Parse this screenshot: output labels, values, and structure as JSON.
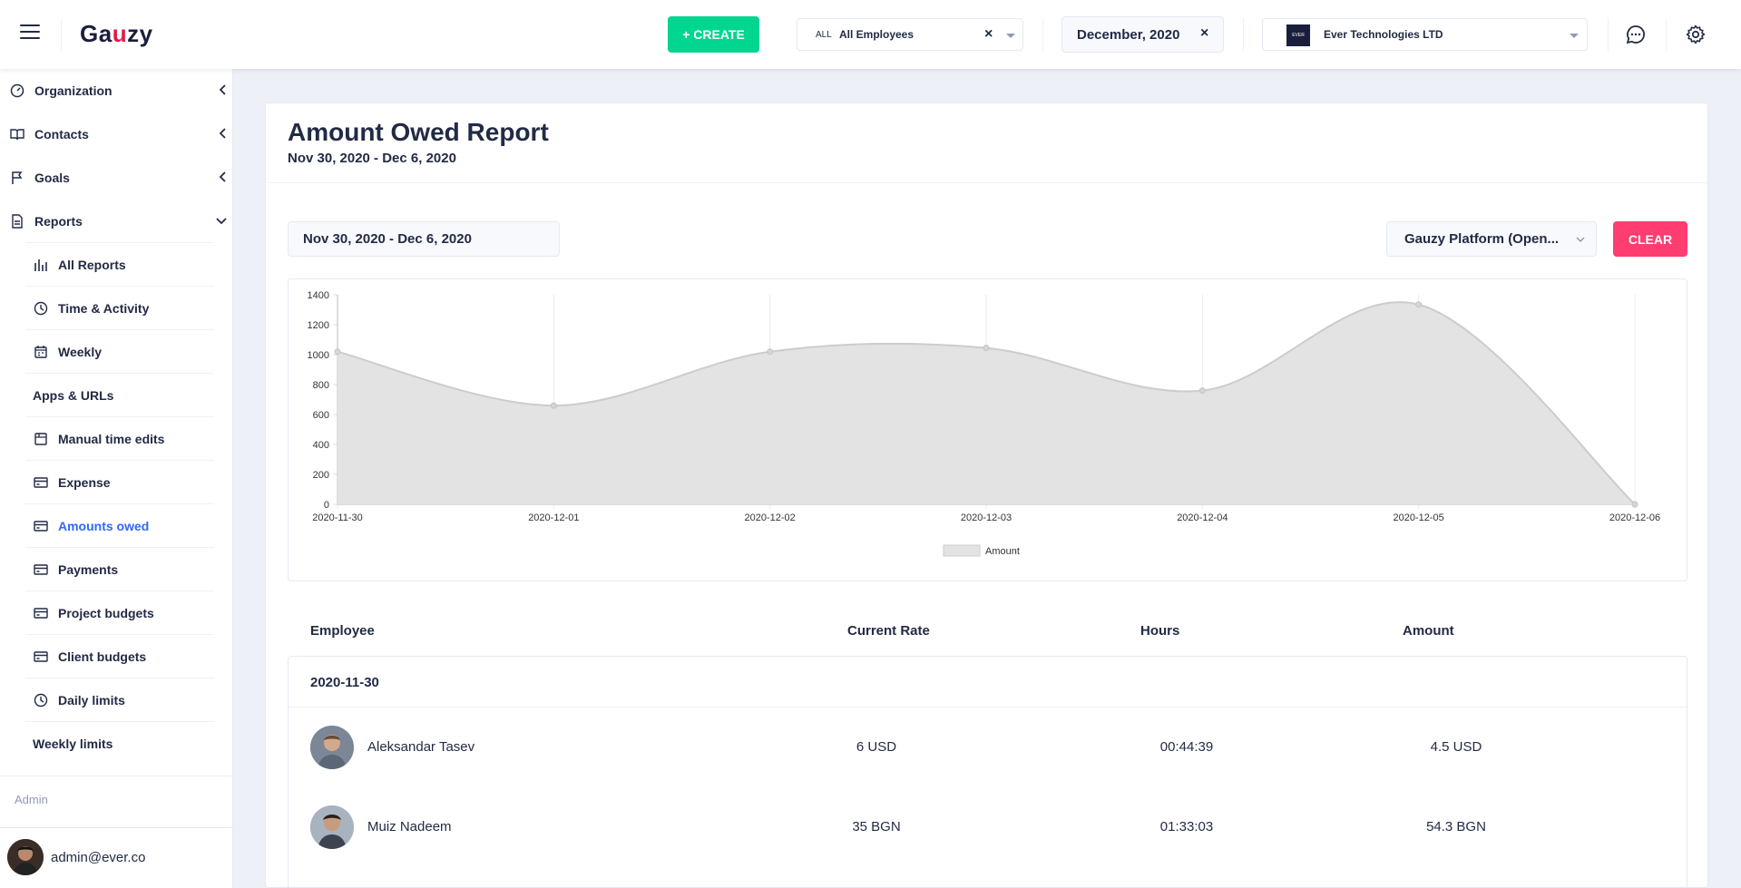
{
  "header": {
    "logo": "Gauzy",
    "create_label": "+ CREATE",
    "employee_badge": "ALL",
    "employee_value": "All Employees",
    "date_value": "December, 2020",
    "org_logo_text": "EVER",
    "org_value": "Ever Technologies LTD",
    "clear_glyph": "×"
  },
  "sidebar": {
    "top_items": [
      {
        "label": "Organization",
        "icon": "dashboard-icon"
      },
      {
        "label": "Contacts",
        "icon": "book-icon"
      },
      {
        "label": "Goals",
        "icon": "flag-icon"
      },
      {
        "label": "Reports",
        "icon": "file-icon"
      }
    ],
    "report_items": [
      {
        "label": "All Reports",
        "icon": "bar-chart-icon"
      },
      {
        "label": "Time & Activity",
        "icon": "clock-icon"
      },
      {
        "label": "Weekly",
        "icon": "calendar-icon"
      },
      {
        "label": "Apps & URLs",
        "icon": ""
      },
      {
        "label": "Manual time edits",
        "icon": "browser-icon"
      },
      {
        "label": "Expense",
        "icon": "credit-card-icon"
      },
      {
        "label": "Amounts owed",
        "icon": "credit-card-icon"
      },
      {
        "label": "Payments",
        "icon": "credit-card-icon"
      },
      {
        "label": "Project budgets",
        "icon": "credit-card-icon"
      },
      {
        "label": "Client budgets",
        "icon": "credit-card-icon"
      },
      {
        "label": "Daily limits",
        "icon": "clock-icon"
      },
      {
        "label": "Weekly limits",
        "icon": ""
      }
    ],
    "admin_label": "Admin",
    "user_email": "admin@ever.co"
  },
  "report": {
    "title": "Amount Owed Report",
    "subtitle": "Nov 30, 2020 - Dec 6, 2020",
    "range_value": "Nov 30, 2020 - Dec 6, 2020",
    "project_value": "Gauzy Platform (Open...",
    "clear_label": "CLEAR"
  },
  "chart_data": {
    "type": "area",
    "x": [
      "2020-11-30",
      "2020-12-01",
      "2020-12-02",
      "2020-12-03",
      "2020-12-04",
      "2020-12-05",
      "2020-12-06"
    ],
    "series": [
      {
        "name": "Amount",
        "values": [
          1020,
          660,
          1020,
          1045,
          760,
          1335,
          0
        ]
      }
    ],
    "ylim": [
      0,
      1400
    ],
    "yticks": [
      0,
      200,
      400,
      600,
      800,
      1000,
      1200,
      1400
    ],
    "legend": "bottom",
    "grid": "vertical",
    "colors": {
      "fill": "#e3e3e3",
      "stroke": "#cccccc"
    }
  },
  "table": {
    "headers": [
      "Employee",
      "Current Rate",
      "Hours",
      "Amount"
    ],
    "group_date": "2020-11-30",
    "rows": [
      {
        "name": "Aleksandar Tasev",
        "rate": "6 USD",
        "hours": "00:44:39",
        "amount": "4.5 USD"
      },
      {
        "name": "Muiz Nadeem",
        "rate": "35 BGN",
        "hours": "01:33:03",
        "amount": "54.3 BGN"
      }
    ]
  }
}
